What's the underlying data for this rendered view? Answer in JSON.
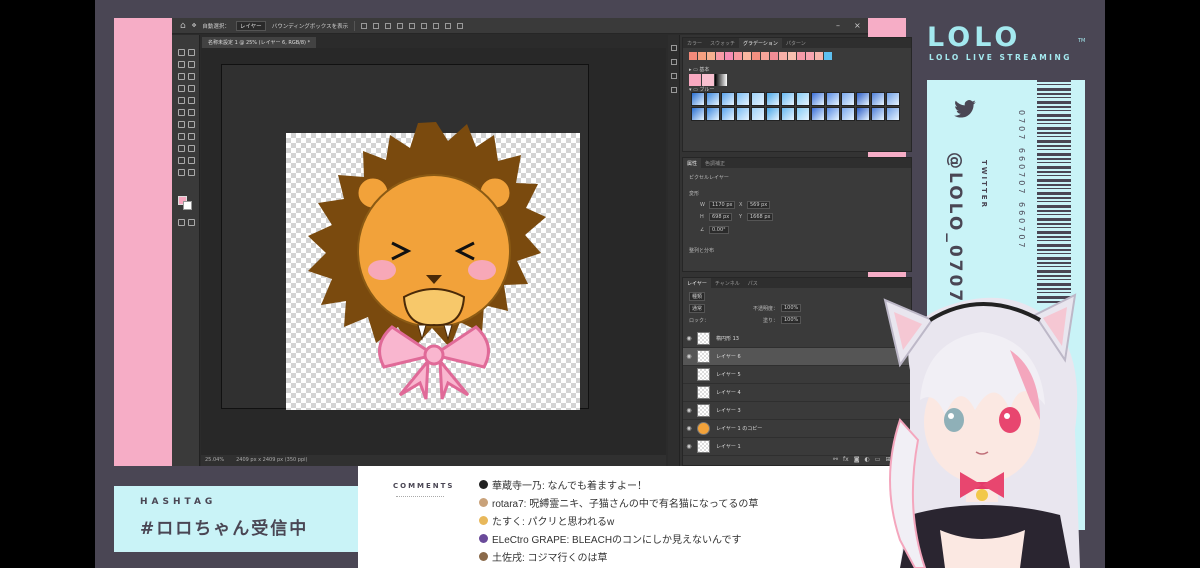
{
  "photoshop": {
    "menubar": {
      "auto_select": "自動選択：",
      "auto_select_value": "レイヤー",
      "bounding_box": "バウンディングボックスを表示"
    },
    "doc_tab": "名称未設定 1 @ 25% (レイヤー 6, RGB/8) *",
    "status": {
      "zoom": "25.04%",
      "size": "2409 px x 2409 px (350 ppi)"
    },
    "color_panel": {
      "tabs": [
        "カラー",
        "スウォッチ",
        "グラデーション",
        "パターン"
      ],
      "active_tab": "グラデーション",
      "folders": [
        "基本",
        "ブルー"
      ]
    },
    "properties_panel": {
      "tabs": [
        "属性",
        "色調補正"
      ],
      "layer_type": "ピクセルレイヤー",
      "section_transform": "変形",
      "w": "1170 px",
      "x": "569 px",
      "h": "698 px",
      "y": "1668 px",
      "angle": "0.00°",
      "section_align": "整列と分布"
    },
    "layers_panel": {
      "tabs": [
        "レイヤー",
        "チャンネル",
        "パス"
      ],
      "filter": "種類",
      "blend_mode": "通常",
      "opacity_label": "不透明度：",
      "opacity": "100%",
      "lock_label": "ロック：",
      "fill_label": "塗り：",
      "fill": "100%",
      "layers": [
        {
          "name": "楕円形 13",
          "visible": true,
          "selected": false
        },
        {
          "name": "レイヤー 6",
          "visible": true,
          "selected": true
        },
        {
          "name": "レイヤー 5",
          "visible": false,
          "selected": false
        },
        {
          "name": "レイヤー 4",
          "visible": false,
          "selected": false
        },
        {
          "name": "レイヤー 3",
          "visible": true,
          "selected": false
        },
        {
          "name": "レイヤー 1 のコピー",
          "visible": true,
          "selected": false
        },
        {
          "name": "レイヤー 1",
          "visible": true,
          "selected": false
        }
      ]
    }
  },
  "brand": {
    "logo": "LOLO",
    "logo_tm": "TM",
    "subtitle": "LOLO LIVE STREAMING",
    "twitter_label": "TWITTER",
    "twitter_handle": "@LOLO_0707",
    "barcode_number": "0707 660707 660707"
  },
  "hashtag": {
    "title": "HASHTAG",
    "text": "#ロロちゃん受信中"
  },
  "comments": {
    "label": "COMMENTS",
    "items": [
      {
        "text": "華蔵寺一乃: なんでも着ますよー！",
        "avatar_color": "#222222"
      },
      {
        "text": "rotara7: 呪縛霊ニキ、子猫さんの中で有名猫になってるの草",
        "avatar_color": "#c9a27a"
      },
      {
        "text": "たすく: パクリと思われるw",
        "avatar_color": "#e8b85b"
      },
      {
        "text": "ELeCtro GRAPE: BLEACHのコンにしか見えないんです",
        "avatar_color": "#6a4a9a"
      },
      {
        "text": "土佐戌: コジマ行くのは草",
        "avatar_color": "#8a6a4a"
      }
    ]
  },
  "colors": {
    "frame": "#4a4654",
    "pink": "#f6adc6",
    "cyan": "#c9f3f7",
    "accent_text": "#a4e9ef"
  }
}
